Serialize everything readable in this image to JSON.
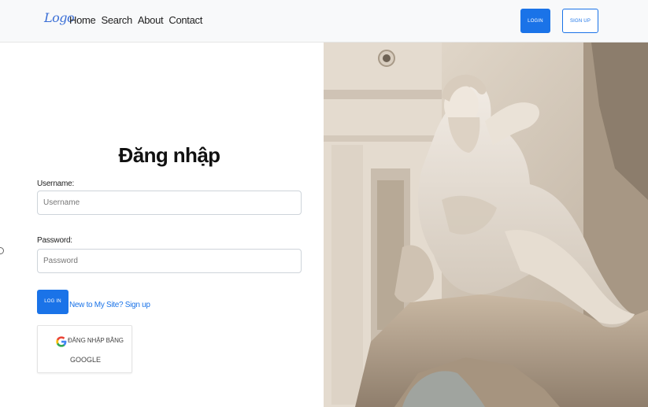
{
  "navbar": {
    "logo_text": "Logo",
    "links": [
      "Home",
      "Search",
      "About",
      "Contact"
    ],
    "login_label": "LOGIN",
    "signup_label": "SIGN UP"
  },
  "form": {
    "title": "Đăng nhập",
    "username_label": "Username:",
    "username_placeholder": "Username",
    "password_label": "Password:",
    "password_placeholder": "Password",
    "login_button": "LOG IN",
    "signup_link": "New to My Site? Sign up",
    "google_button_line1": "ĐĂNG NHẬP BẰNG",
    "google_button_line2": "GOOGLE"
  },
  "hero": {
    "image": "statue-fountain-photo"
  },
  "colors": {
    "accent": "#1a73e8",
    "navbar_bg": "#f8f9fa",
    "logo": "#3b6fd6"
  }
}
